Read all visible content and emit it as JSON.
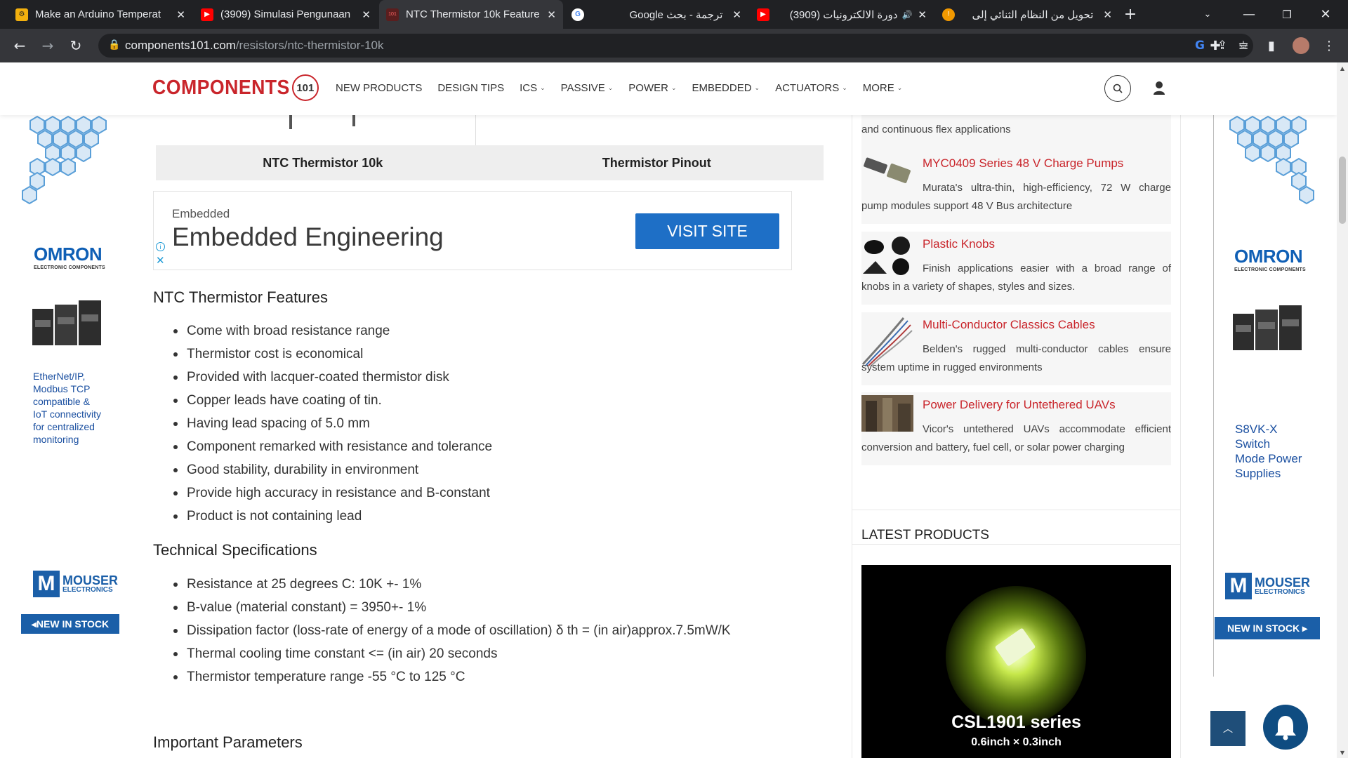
{
  "browser": {
    "tabs": [
      {
        "title": "Make an Arduino Temperat",
        "favicon": "instructables-icon"
      },
      {
        "title": "(3909) Simulasi Pengunaan",
        "favicon": "youtube-icon"
      },
      {
        "title": "NTC Thermistor 10k Feature",
        "favicon": "components101-icon",
        "active": true
      },
      {
        "title": "Google ترجمة - بحث",
        "favicon": "google-icon"
      },
      {
        "title": "(3909) دورة الالكترونيات",
        "favicon": "youtube-icon",
        "audio": true
      },
      {
        "title": "تحويل من النظام الثنائي إلى",
        "favicon": "info-icon"
      }
    ],
    "url_host": "components101.com",
    "url_path": "/resistors/ntc-thermistor-10k"
  },
  "site": {
    "logo_word": "COMPONENTS",
    "logo_num": "101",
    "menu": [
      {
        "label": "NEW PRODUCTS",
        "dropdown": false
      },
      {
        "label": "DESIGN TIPS",
        "dropdown": false
      },
      {
        "label": "ICS",
        "dropdown": true
      },
      {
        "label": "PASSIVE",
        "dropdown": true
      },
      {
        "label": "POWER",
        "dropdown": true
      },
      {
        "label": "EMBEDDED",
        "dropdown": true
      },
      {
        "label": "ACTUATORS",
        "dropdown": true
      },
      {
        "label": "MORE",
        "dropdown": true
      }
    ]
  },
  "left_ad": {
    "omron": "OMRON",
    "omron_sub": "ELECTRONIC COMPONENTS",
    "text": [
      "EtherNet/IP,",
      "Modbus TCP",
      "compatible &",
      "IoT connectivity",
      "for centralized",
      "monitoring"
    ],
    "mouser_a": "MOUSER",
    "mouser_b": "ELECTRONICS",
    "stock": "◂NEW IN STOCK"
  },
  "right_ad": {
    "omron": "OMRON",
    "omron_sub": "ELECTRONIC COMPONENTS",
    "text": [
      "S8VK-X",
      "Switch",
      "Mode Power",
      "Supplies"
    ],
    "mouser_a": "MOUSER",
    "mouser_b": "ELECTRONICS",
    "stock": "NEW IN STOCK ▸"
  },
  "main": {
    "image_tabs": [
      "NTC Thermistor 10k",
      "Thermistor Pinout"
    ],
    "ad": {
      "small": "Embedded",
      "big": "Embedded Engineering",
      "button": "VISIT SITE"
    },
    "features_title": "NTC Thermistor Features",
    "features": [
      "Come with broad resistance range",
      "Thermistor cost is economical",
      "Provided with lacquer-coated thermistor disk",
      "Copper leads have coating of tin.",
      "Having lead spacing of 5.0 mm",
      "Component remarked with resistance and tolerance",
      "Good stability, durability in environment",
      "Provide high accuracy in resistance and B-constant",
      "Product is not containing lead"
    ],
    "specs_title": "Technical Specifications",
    "specs": [
      "Resistance at 25 degrees C: 10K +- 1%",
      "B-value (material constant) = 3950+- 1%",
      "Dissipation factor (loss-rate of energy of a mode of oscillation) δ th = (in air)approx.7.5mW/K",
      "Thermal cooling time constant <= (in air) 20 seconds",
      "Thermistor temperature range -55 °C to 125 °C"
    ],
    "params_title": "Important Parameters"
  },
  "sidebar": {
    "partial_desc": "and continuous flex applications",
    "items": [
      {
        "title": "MYC0409 Series 48 V Charge Pumps",
        "desc": "Murata's ultra-thin, high-efficiency, 72 W charge pump modules support 48 V Bus architecture"
      },
      {
        "title": "Plastic Knobs",
        "desc": "Finish applications easier with a broad range of knobs in a variety of shapes, styles and sizes."
      },
      {
        "title": "Multi-Conductor Classics Cables",
        "desc": "Belden's rugged multi-conductor cables ensure system uptime in rugged environments"
      },
      {
        "title": "Power Delivery for Untethered UAVs",
        "desc": "Vicor's untethered UAVs accommodate efficient conversion and battery, fuel cell, or solar power charging"
      }
    ],
    "latest_title": "LATEST PRODUCTS",
    "latest_caption": "CSL1901 series",
    "latest_sub": "0.6inch × 0.3inch"
  }
}
